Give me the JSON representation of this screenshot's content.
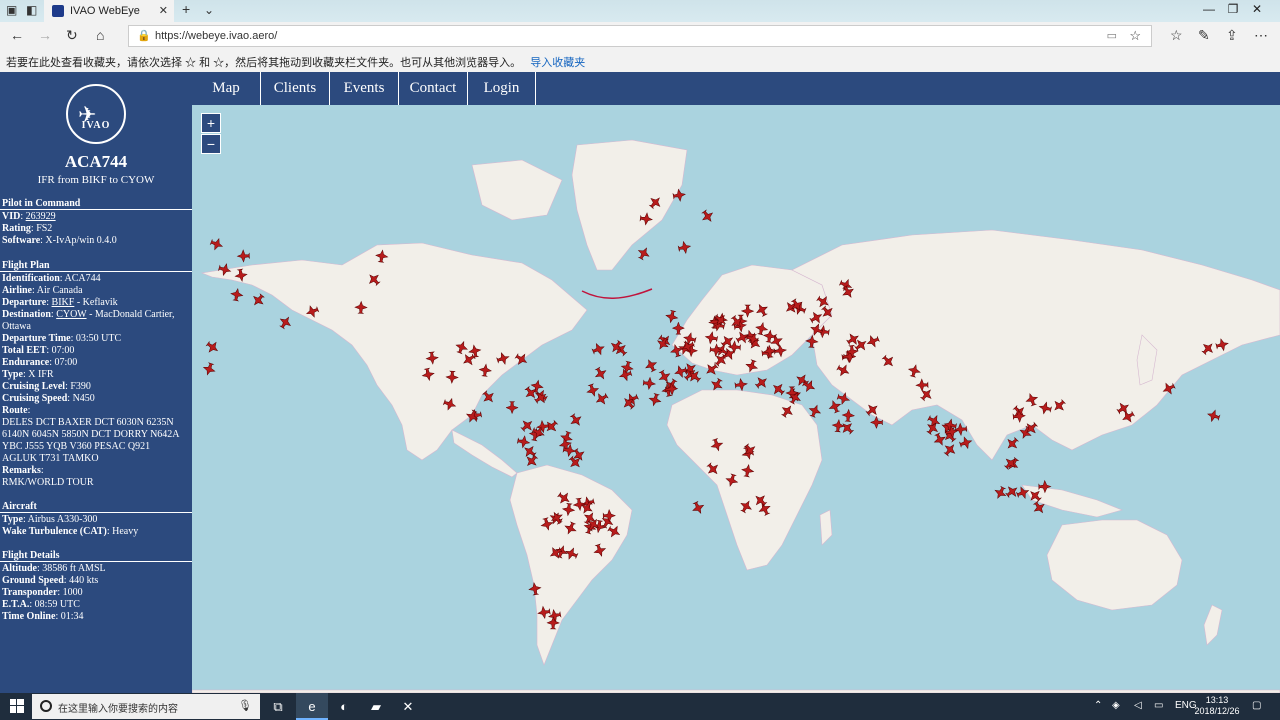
{
  "browser": {
    "tab_title": "IVAO WebEye",
    "address": "https://webeye.ivao.aero/",
    "favorites_hint": "若要在此处查看收藏夹，请依次选择 ☆ 和 ☆，然后将其拖动到收藏夹栏文件夹。也可从其他浏览器导入。",
    "favorites_link": "导入收藏夹"
  },
  "sidebar": {
    "logo_text": "IVAO",
    "callsign": "ACA744",
    "route_short": "IFR from BIKF to CYOW",
    "pilot_section": "Pilot in Command",
    "vid_label": "VID",
    "vid": "263929",
    "rating_label": "Rating",
    "rating": "FS2",
    "software_label": "Software",
    "software": "X-IvAp/win 0.4.0",
    "plan_section": "Flight Plan",
    "ident_label": "Identification",
    "ident": "ACA744",
    "airline_label": "Airline",
    "airline": "Air Canada",
    "departure_label": "Departure",
    "departure_code": "BIKF",
    "departure_name": "- Keflavik",
    "destination_label": "Destination",
    "destination_code": "CYOW",
    "destination_name": "- MacDonald Cartier,",
    "destination_city": "Ottawa",
    "dep_time_label": "Departure Time",
    "dep_time": "03:50 UTC",
    "eet_label": "Total EET",
    "eet": "07:00",
    "endurance_label": "Endurance",
    "endurance": "07:00",
    "type_label": "Type",
    "type": "X IFR",
    "level_label": "Cruising Level",
    "level": "F390",
    "speed_label": "Cruising Speed",
    "speed": "N450",
    "route_label": "Route",
    "route_lines": [
      "DELES DCT BAXER DCT 6030N 6235N",
      "6140N 6045N 5850N DCT DORRY N642A",
      "YBC J555 YQB V360 PESAC Q921",
      "AGLUK T731 TAMKO"
    ],
    "remarks_label": "Remarks",
    "remarks": "RMK/WORLD TOUR",
    "aircraft_section": "Aircraft",
    "ac_type_label": "Type",
    "ac_type": "Airbus A330-300",
    "wake_label": "Wake Turbulence (CAT)",
    "wake": "Heavy",
    "details_section": "Flight Details",
    "altitude_label": "Altitude",
    "altitude": "38586 ft AMSL",
    "gs_label": "Ground Speed",
    "gs": "440 kts",
    "xpdr_label": "Transponder",
    "xpdr": "1000",
    "eta_label": "E.T.A.",
    "eta": "08:59 UTC",
    "online_label": "Time Online",
    "online": "01:34"
  },
  "topnav": [
    "Map",
    "Clients",
    "Events",
    "Contact",
    "Login"
  ],
  "map": {
    "zoom_in": "+",
    "zoom_out": "−",
    "water_color": "#aad3df",
    "land_color": "#f2efe9",
    "aircraft_color": "#b71c1c"
  },
  "taskbar": {
    "search_placeholder": "在这里输入你要搜索的内容",
    "lang": "ENG",
    "time": "13:13",
    "date": "2018/12/26"
  }
}
